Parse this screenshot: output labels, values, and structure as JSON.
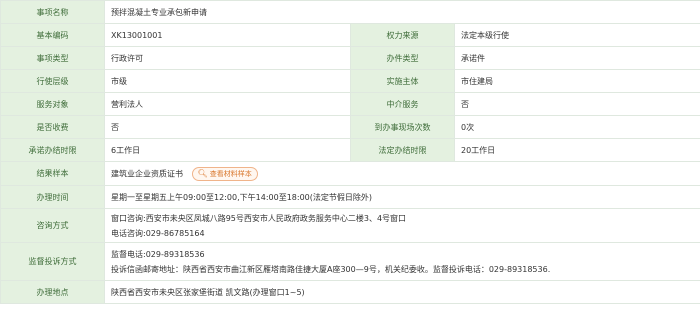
{
  "rows": {
    "item_name": {
      "label": "事项名称",
      "value": "预拌混凝土专业承包新申请"
    },
    "basic_code": {
      "label": "基本编码",
      "value": "XK13001001"
    },
    "authority_source": {
      "label": "权力来源",
      "value": "法定本级行使"
    },
    "item_type": {
      "label": "事项类型",
      "value": "行政许可"
    },
    "handling_type": {
      "label": "办件类型",
      "value": "承诺件"
    },
    "exercise_level": {
      "label": "行使层级",
      "value": "市级"
    },
    "implementing_body": {
      "label": "实施主体",
      "value": "市住建局"
    },
    "service_target": {
      "label": "服务对象",
      "value": "营利法人"
    },
    "intermediary": {
      "label": "中介服务",
      "value": "否"
    },
    "fee": {
      "label": "是否收费",
      "value": "否"
    },
    "site_visits": {
      "label": "到办事现场次数",
      "value": "0次"
    },
    "promised_time": {
      "label": "承诺办结时限",
      "value": "6工作日"
    },
    "legal_time": {
      "label": "法定办结时限",
      "value": "20工作日"
    },
    "result_sample": {
      "label": "结果样本",
      "value": "建筑业企业资质证书",
      "sample_button": "查看材料样本",
      "sample_icon": "search-icon"
    },
    "office_hours": {
      "label": "办理时间",
      "value": "星期一至星期五上午09:00至12:00,下午14:00至18:00(法定节假日除外)"
    },
    "consult": {
      "label": "咨询方式",
      "lines": [
        "窗口咨询:西安市未央区凤城八路95号西安市人民政府政务服务中心二楼3、4号窗口",
        "电话咨询:029-86785164"
      ]
    },
    "supervision": {
      "label": "监督投诉方式",
      "lines": [
        "监督电话:029-89318536",
        "投诉信函邮寄地址：陕西省西安市曲江新区雁塔南路佳捷大厦A座300—9号，机关纪委收。监督投诉电话：029-89318536."
      ]
    },
    "location": {
      "label": "办理地点",
      "value": "陕西省西安市未央区张家堡街道 凯文路(办理窗口1~5)"
    }
  }
}
